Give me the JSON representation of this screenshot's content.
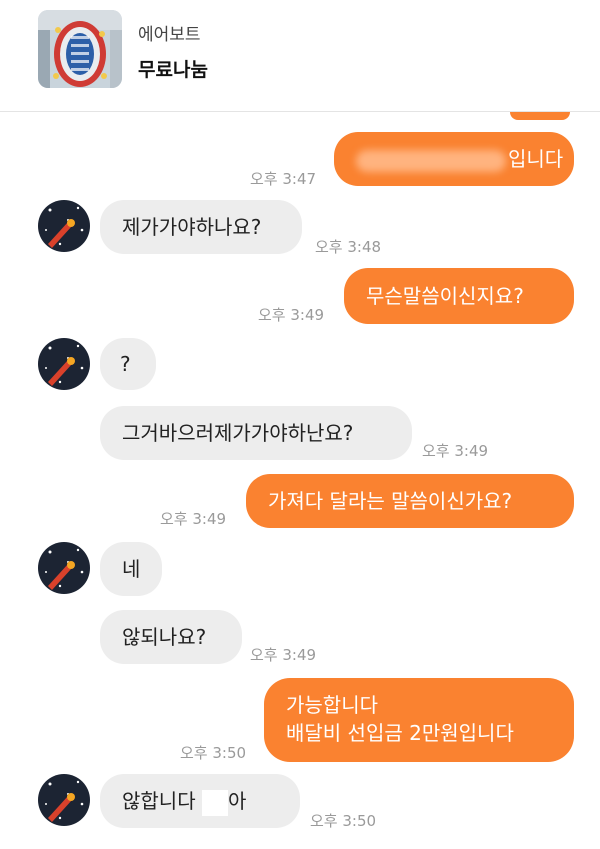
{
  "product": {
    "subtitle": "에어보트",
    "title": "무료나눔"
  },
  "colors": {
    "accent": "#fa8230",
    "incoming_bubble": "#ededed"
  },
  "messages": [
    {
      "side": "out",
      "text": "입니다",
      "time": "오후 3:47",
      "note": "partially blurred"
    },
    {
      "side": "in",
      "text": "제가가야하나요?",
      "time": "오후 3:48"
    },
    {
      "side": "out",
      "text": "무슨말씀이신지요?",
      "time": "오후 3:49"
    },
    {
      "side": "in",
      "text": "?",
      "time": ""
    },
    {
      "side": "in",
      "text": "그거바으러제가가야하난요?",
      "time": "오후 3:49"
    },
    {
      "side": "out",
      "text": "가져다 달라는 말씀이신가요?",
      "time": "오후 3:49"
    },
    {
      "side": "in",
      "text": "네",
      "time": ""
    },
    {
      "side": "in",
      "text": "않되나요?",
      "time": "오후 3:49"
    },
    {
      "side": "out",
      "text": "가능합니다",
      "text2": "배달비 선입금 2만원입니다",
      "time": "오후 3:50"
    },
    {
      "side": "in",
      "text": "않합니다 ",
      "text_tail": "아",
      "time": "오후 3:50"
    }
  ]
}
